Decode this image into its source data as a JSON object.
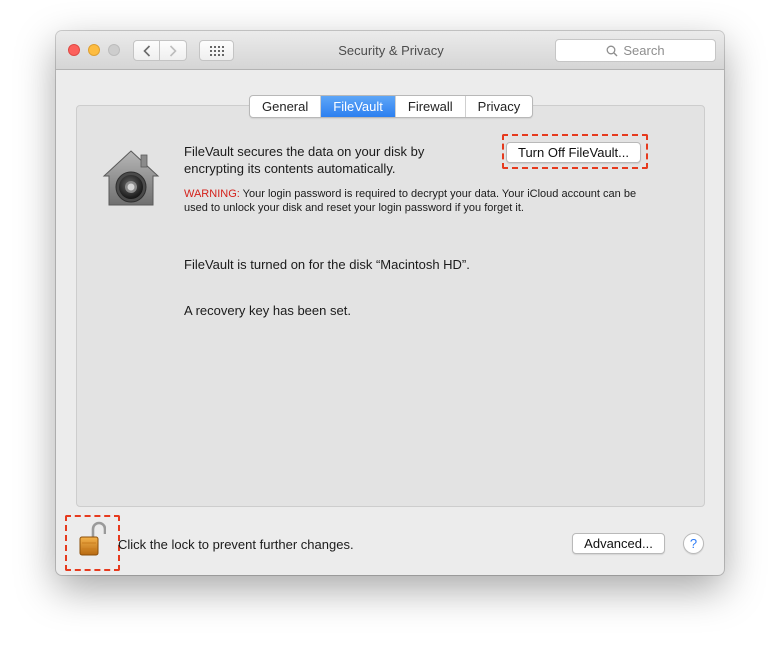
{
  "window": {
    "title": "Security & Privacy",
    "search_placeholder": "Search"
  },
  "tabs": [
    {
      "label": "General",
      "active": false
    },
    {
      "label": "FileVault",
      "active": true
    },
    {
      "label": "Firewall",
      "active": false
    },
    {
      "label": "Privacy",
      "active": false
    }
  ],
  "filevault": {
    "description": "FileVault secures the data on your disk by encrypting its contents automatically.",
    "turn_off_label": "Turn Off FileVault...",
    "warning_label": "WARNING:",
    "warning_text": " Your login password is required to decrypt your data. Your iCloud account can be used to unlock your disk and reset your login password if you forget it.",
    "status_on": "FileVault is turned on for the disk “Macintosh HD”.",
    "status_recovery": "A recovery key has been set."
  },
  "footer": {
    "lock_text": "Click the lock to prevent further changes.",
    "advanced_label": "Advanced...",
    "help_label": "?"
  },
  "colors": {
    "accent": "#2c7ff0",
    "warning": "#d4211b",
    "highlight": "#e63a1e"
  }
}
